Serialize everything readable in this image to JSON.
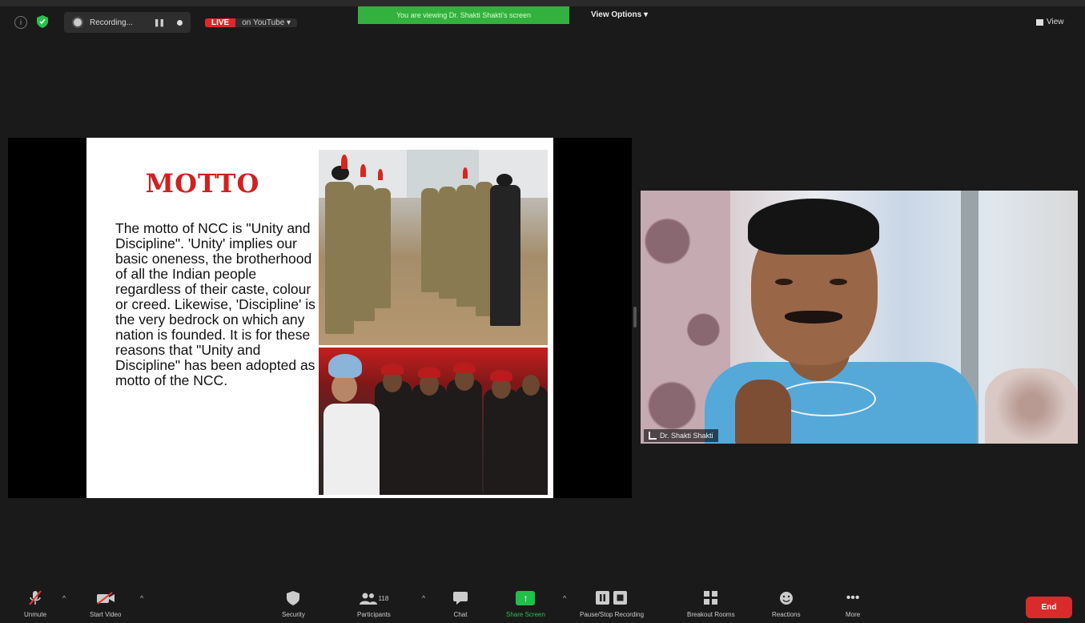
{
  "top_bar": {
    "recording_label": "Recording...",
    "live_label": "LIVE",
    "youtube_label": "on YouTube ▾",
    "viewing_banner": "You are viewing Dr. Shakti Shakti's screen",
    "view_options_label": "View Options ▾",
    "view_label": "View"
  },
  "slide": {
    "title": "MOTTO",
    "body": "The motto of NCC is \"Unity and Discipline\". 'Unity' implies our basic oneness, the brotherhood of all the Indian people regardless of their caste, colour or creed. Likewise, 'Discipline' is the very bedrock on which any nation is founded. It is for these reasons that \"Unity and Discipline\" has been adopted as motto of the NCC."
  },
  "speaker": {
    "name": "Dr. Shakti Shakti"
  },
  "toolbar": {
    "unmute": "Unmute",
    "start_video": "Start Video",
    "security": "Security",
    "participants": "Participants",
    "participants_count": "118",
    "chat": "Chat",
    "share_screen": "Share Screen",
    "pause_stop_recording": "Pause/Stop Recording",
    "breakout_rooms": "Breakout Rooms",
    "reactions": "Reactions",
    "more": "More",
    "end": "End"
  },
  "colors": {
    "live_red": "#e02828",
    "banner_green": "#33b13e",
    "share_green": "#1fbf4a",
    "end_red": "#d92b2b",
    "motto_red": "#d21f1f"
  }
}
